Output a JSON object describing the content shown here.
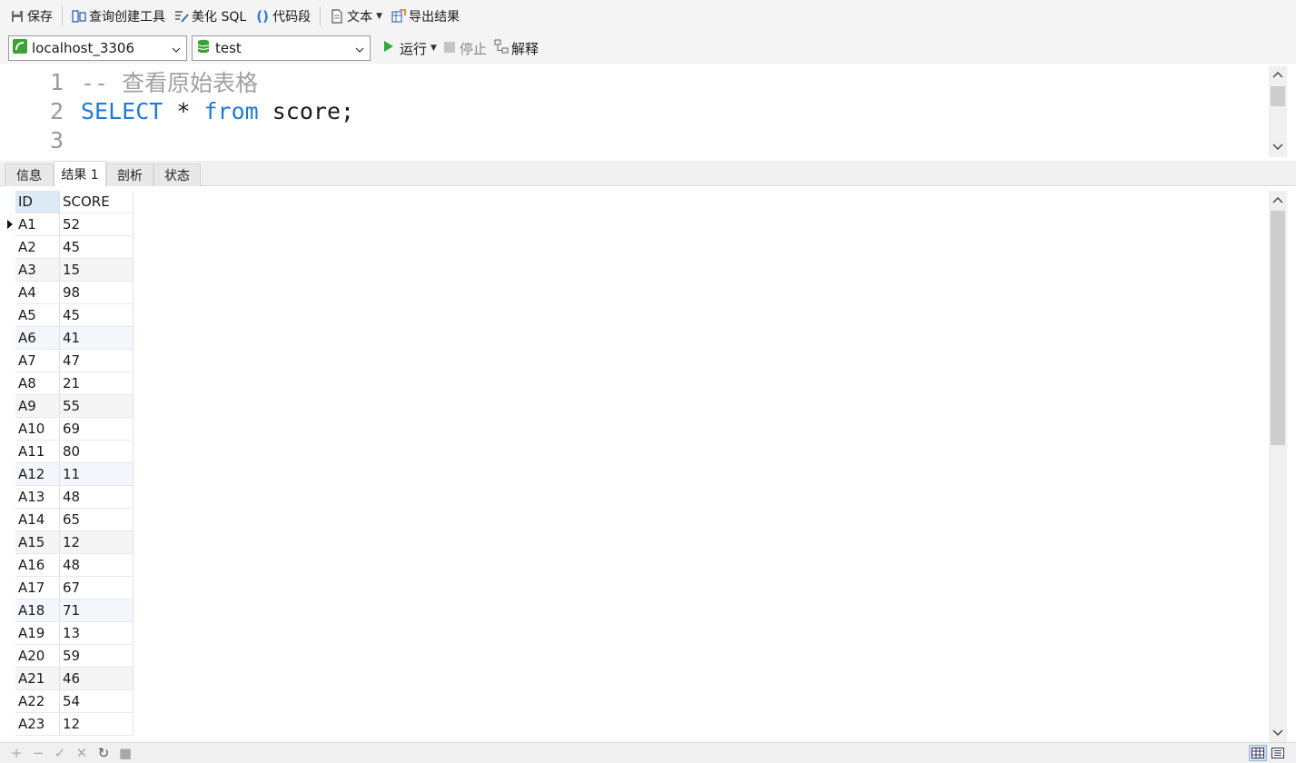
{
  "toolbar": {
    "save": "保存",
    "query_builder": "查询创建工具",
    "beautify_sql": "美化 SQL",
    "code_snippet": "代码段",
    "text": "文本",
    "export_result": "导出结果"
  },
  "connection": {
    "server": "localhost_3306",
    "database": "test"
  },
  "actions": {
    "run": "运行",
    "stop": "停止",
    "explain": "解释"
  },
  "editor": {
    "lines": [
      {
        "num": "1",
        "text": "-- 查看原始表格"
      },
      {
        "num": "2",
        "kw1": "SELECT",
        "mid": " * ",
        "kw2": "from",
        "rest": " score;"
      },
      {
        "num": "3"
      }
    ]
  },
  "tabs": [
    "信息",
    "结果 1",
    "剖析",
    "状态"
  ],
  "result": {
    "columns": [
      "ID",
      "SCORE"
    ],
    "rows": [
      [
        "A1",
        "52"
      ],
      [
        "A2",
        "45"
      ],
      [
        "A3",
        "15"
      ],
      [
        "A4",
        "98"
      ],
      [
        "A5",
        "45"
      ],
      [
        "A6",
        "41"
      ],
      [
        "A7",
        "47"
      ],
      [
        "A8",
        "21"
      ],
      [
        "A9",
        "55"
      ],
      [
        "A10",
        "69"
      ],
      [
        "A11",
        "80"
      ],
      [
        "A12",
        "11"
      ],
      [
        "A13",
        "48"
      ],
      [
        "A14",
        "65"
      ],
      [
        "A15",
        "12"
      ],
      [
        "A16",
        "48"
      ],
      [
        "A17",
        "67"
      ],
      [
        "A18",
        "71"
      ],
      [
        "A19",
        "13"
      ],
      [
        "A20",
        "59"
      ],
      [
        "A21",
        "46"
      ],
      [
        "A22",
        "54"
      ],
      [
        "A23",
        "12"
      ]
    ]
  },
  "colors": {
    "keyword": "#1e7bd8",
    "comment": "#a0a0a0",
    "run_green": "#2eaa3a",
    "db_green": "#3aa335"
  }
}
